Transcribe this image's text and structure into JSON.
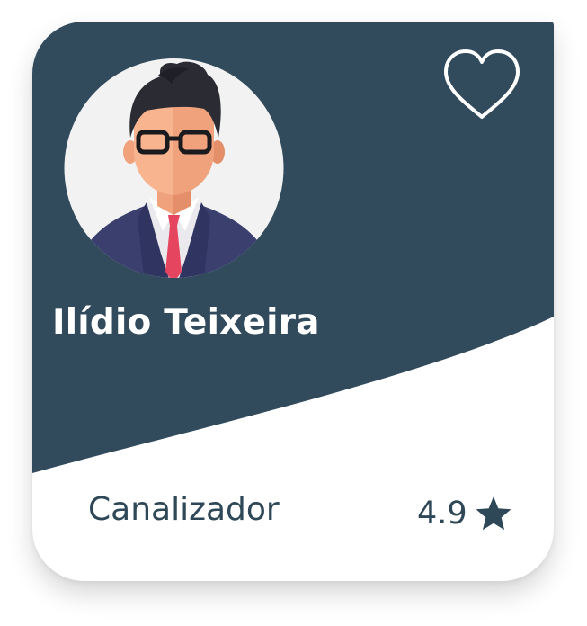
{
  "card": {
    "name": "Ilídio Teixeira",
    "profession": "Canalizador",
    "rating": "4.9",
    "favorite_icon": "heart-outline-icon",
    "rating_icon": "star-icon",
    "avatar_icon": "businessman-avatar"
  },
  "colors": {
    "header": "#314a5c",
    "text_dark": "#2f4858",
    "background": "#ffffff"
  }
}
